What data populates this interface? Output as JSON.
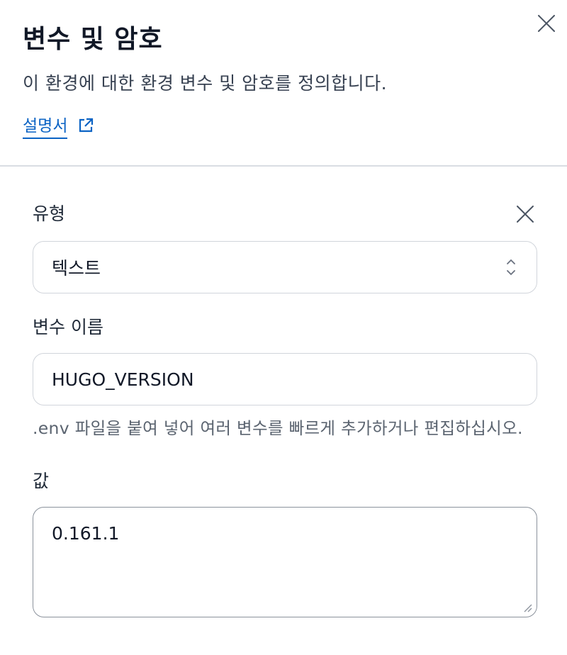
{
  "panel": {
    "title": "변수 및 암호",
    "subtitle": "이 환경에 대한 환경 변수 및 암호를 정의합니다.",
    "doc_link": "설명서"
  },
  "variable": {
    "type_label": "유형",
    "type_value": "텍스트",
    "name_label": "변수 이름",
    "name_value": "HUGO_VERSION",
    "help_text": ".env 파일을 붙여 넣어 여러 변수를 빠르게 추가하거나 편집하십시오.",
    "value_label": "값",
    "value_value": "0.161.1"
  },
  "colors": {
    "link": "#0b63c4",
    "border": "#d1d5db",
    "divider": "#d9dde3"
  }
}
